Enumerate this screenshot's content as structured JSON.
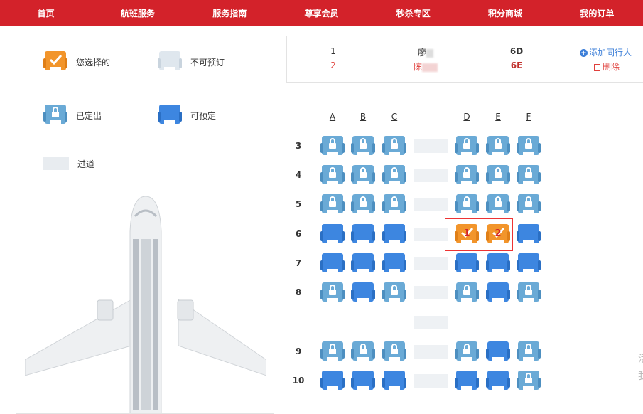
{
  "nav": [
    "首页",
    "航班服务",
    "服务指南",
    "尊享会员",
    "秒杀专区",
    "积分商城",
    "我的订单"
  ],
  "legend": {
    "selected": "您选择的",
    "unavailable": "不可预订",
    "sold": "已定出",
    "available": "可预定",
    "aisle": "过道"
  },
  "passengers": [
    {
      "index": "1",
      "name": "廖",
      "seat": "6D",
      "action": "添加同行人",
      "highlight": false
    },
    {
      "index": "2",
      "name": "陈",
      "seat": "6E",
      "action": "删除",
      "highlight": true
    }
  ],
  "columns": [
    "A",
    "B",
    "C",
    "D",
    "E",
    "F"
  ],
  "rows": [
    {
      "label": "3",
      "seats": [
        "sold",
        "sold",
        "sold",
        "sold",
        "sold",
        "sold"
      ]
    },
    {
      "label": "4",
      "seats": [
        "sold",
        "sold",
        "sold",
        "sold",
        "sold",
        "sold"
      ]
    },
    {
      "label": "5",
      "seats": [
        "sold",
        "sold",
        "sold",
        "sold",
        "sold",
        "sold"
      ]
    },
    {
      "label": "6",
      "seats": [
        "available",
        "available",
        "available",
        "selected",
        "selected",
        "available"
      ],
      "selected_numbers": [
        "",
        "",
        "",
        "1",
        "2",
        ""
      ]
    },
    {
      "label": "7",
      "seats": [
        "available",
        "available",
        "available",
        "available",
        "available",
        "available"
      ]
    },
    {
      "label": "8",
      "seats": [
        "sold",
        "available",
        "sold",
        "sold",
        "available",
        "sold"
      ]
    },
    {
      "label": "",
      "seats": []
    },
    {
      "label": "9",
      "seats": [
        "sold",
        "sold",
        "sold",
        "sold",
        "available",
        "sold"
      ]
    },
    {
      "label": "10",
      "seats": [
        "available",
        "available",
        "available",
        "available",
        "available",
        "sold"
      ]
    }
  ],
  "edge_text": [
    "活",
    "我"
  ],
  "colors": {
    "brand_red": "#d3222a",
    "sold_blue": "#6aaad6",
    "available_blue": "#3d86e0",
    "selected_orange": "#f2952b",
    "unavailable_grey": "#dfe7ee"
  }
}
